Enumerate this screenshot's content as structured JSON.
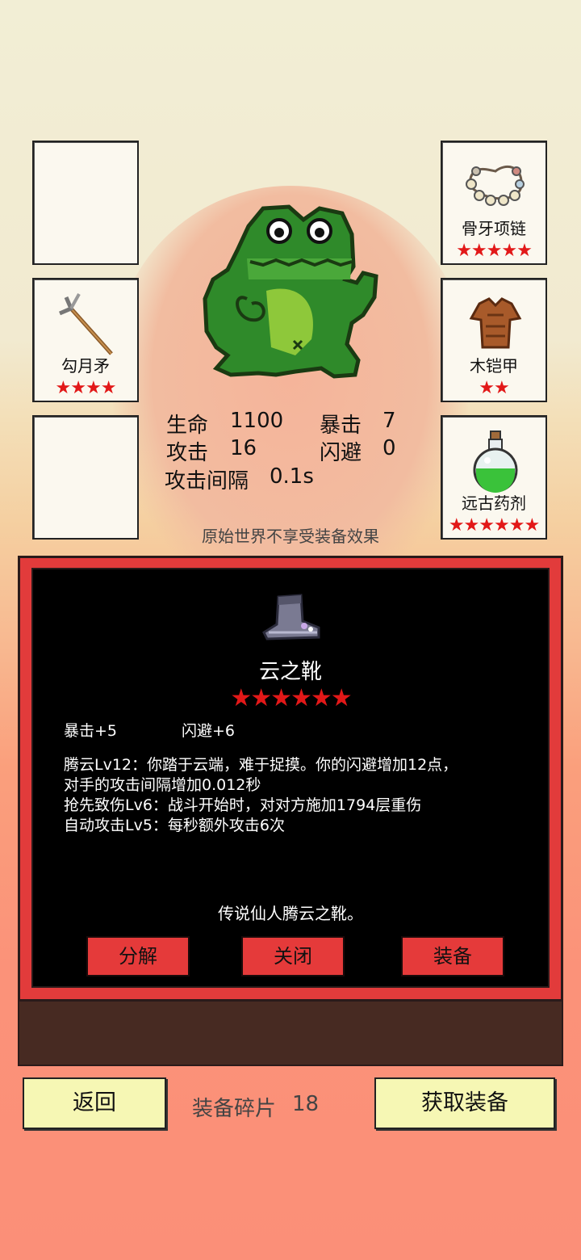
{
  "equipment_slots": {
    "left": [
      {
        "name": "",
        "stars": ""
      },
      {
        "name": "勾月矛",
        "stars": "★★★★",
        "icon": "spear-icon"
      },
      {
        "name": "",
        "stars": ""
      }
    ],
    "right": [
      {
        "name": "骨牙项链",
        "stars": "★★★★★",
        "icon": "necklace-icon"
      },
      {
        "name": "木铠甲",
        "stars": "★★",
        "icon": "armor-icon"
      },
      {
        "name": "远古药剂",
        "stars": "★★★★★★",
        "icon": "potion-icon"
      }
    ]
  },
  "character": {
    "icon": "frog-character-icon"
  },
  "stats": {
    "hp_label": "生命",
    "hp_value": "1100",
    "crit_label": "暴击",
    "crit_value": "7",
    "atk_label": "攻击",
    "atk_value": "16",
    "dodge_label": "闪避",
    "dodge_value": "0",
    "interval_label": "攻击间隔",
    "interval_value": "0.1s",
    "note": "原始世界不享受装备效果"
  },
  "item_panel": {
    "icon": "boots-icon",
    "name": "云之靴",
    "stars": "★★★★★★",
    "attr1": "暴击+5",
    "attr2": "闪避+6",
    "skills": [
      "腾云Lv12：你踏于云端，难于捉摸。你的闪避增加12点，",
      "对手的攻击间隔增加0.012秒",
      "抢先致伤Lv6：战斗开始时，对对方施加1794层重伤",
      "自动攻击Lv5：每秒额外攻击6次"
    ],
    "flavor": "传说仙人腾云之靴。",
    "buttons": {
      "decompose": "分解",
      "close": "关闭",
      "equip": "装备"
    }
  },
  "footer": {
    "back": "返回",
    "fragments_label": "装备碎片",
    "fragments_value": "18",
    "get_equipment": "获取装备"
  },
  "colors": {
    "star": "#e21818",
    "panel_border": "#e23b3b",
    "button": "#e53a3a",
    "yellow_button": "#f6f7b4"
  }
}
